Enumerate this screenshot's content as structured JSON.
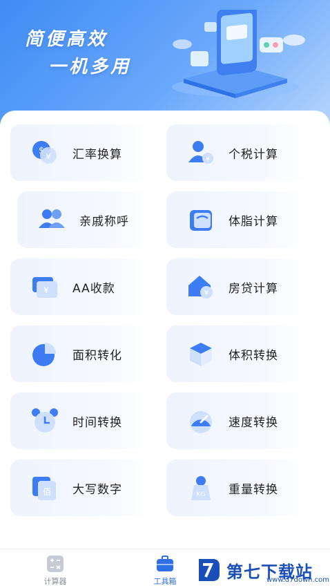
{
  "banner": {
    "line1": "简便高效",
    "line2": "一机多用"
  },
  "tools": [
    {
      "label": "汇率换算",
      "icon": "currency-exchange-icon"
    },
    {
      "label": "个税计算",
      "icon": "personal-tax-icon"
    },
    {
      "label": "亲戚称呼",
      "icon": "relatives-icon"
    },
    {
      "label": "体脂计算",
      "icon": "body-fat-scale-icon"
    },
    {
      "label": "AA收款",
      "icon": "wallet-icon"
    },
    {
      "label": "房贷计算",
      "icon": "house-loan-icon"
    },
    {
      "label": "面积转化",
      "icon": "area-pie-icon"
    },
    {
      "label": "体积转换",
      "icon": "cube-icon"
    },
    {
      "label": "时间转换",
      "icon": "alarm-clock-icon"
    },
    {
      "label": "速度转换",
      "icon": "speedometer-icon"
    },
    {
      "label": "大写数字",
      "icon": "capital-number-icon"
    },
    {
      "label": "重量转换",
      "icon": "weight-kg-icon"
    }
  ],
  "nav": [
    {
      "label": "计算器",
      "icon": "calculator-icon",
      "active": false
    },
    {
      "label": "工具箱",
      "icon": "toolbox-icon",
      "active": true
    }
  ],
  "watermark": {
    "name": "第七下载站",
    "url": "www.d7down.com"
  },
  "colors": {
    "accent": "#2f6fe8",
    "icon_blue": "#3d7cf2",
    "card_bg": "#eef3fd"
  }
}
